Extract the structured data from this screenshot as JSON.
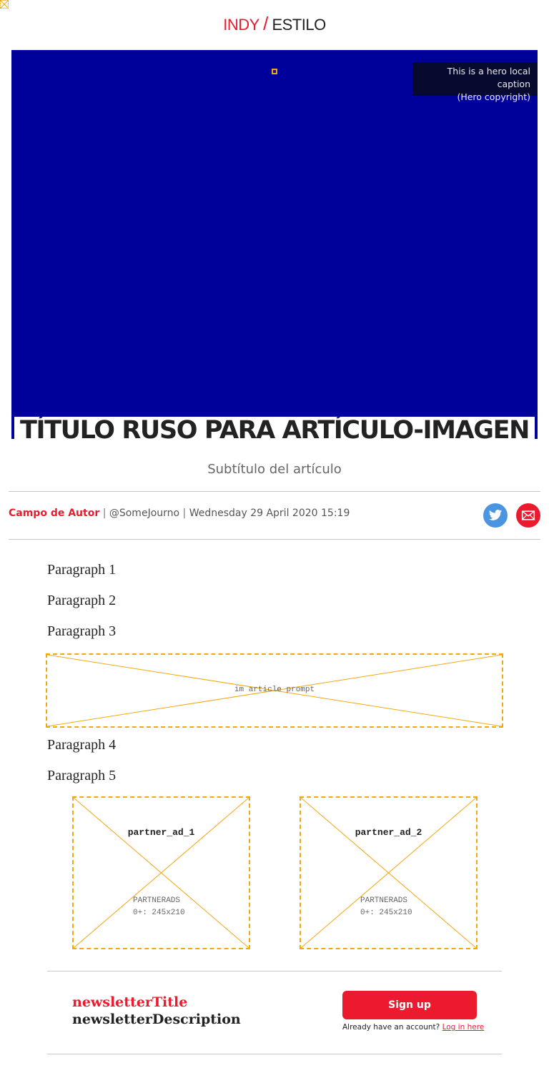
{
  "logo": {
    "brand": "INDY",
    "slash": "/",
    "section": "ESTILO"
  },
  "hero": {
    "caption_line1": "This is a hero local caption",
    "caption_line2": "(Hero copyright)",
    "background_color": "#00009b"
  },
  "article": {
    "headline": "TÍTULO RUSO PARA ARTÍCULO-IMAGEN",
    "subtitle": "Subtítulo del artículo",
    "author": "Campo de Autor",
    "handle": "@SomeJourno",
    "date": "Wednesday 29 April 2020 15:19",
    "separator": "|",
    "paragraphs_top": [
      "Paragraph 1",
      "Paragraph 2",
      "Paragraph 3"
    ],
    "paragraphs_bottom": [
      "Paragraph 4",
      "Paragraph 5"
    ]
  },
  "share": {
    "twitter_icon": "twitter-bird-icon",
    "email_icon": "envelope-icon"
  },
  "placeholders": {
    "article_prompt": "im article prompt",
    "partner_ads": [
      {
        "title": "partner_ad_1",
        "line1": "PARTNERADS",
        "line2": "0+: 245x210"
      },
      {
        "title": "partner_ad_2",
        "line1": "PARTNERADS",
        "line2": "0+: 245x210"
      }
    ]
  },
  "newsletter": {
    "title": "newsletterTitle",
    "description": "newsletterDescription",
    "signup_label": "Sign up",
    "login_prompt": "Already have an account?",
    "login_link": "Log in here"
  },
  "colors": {
    "accent": "#ec1a2e",
    "placeholder_border": "#f3a712",
    "twitter": "#4b94e1"
  }
}
